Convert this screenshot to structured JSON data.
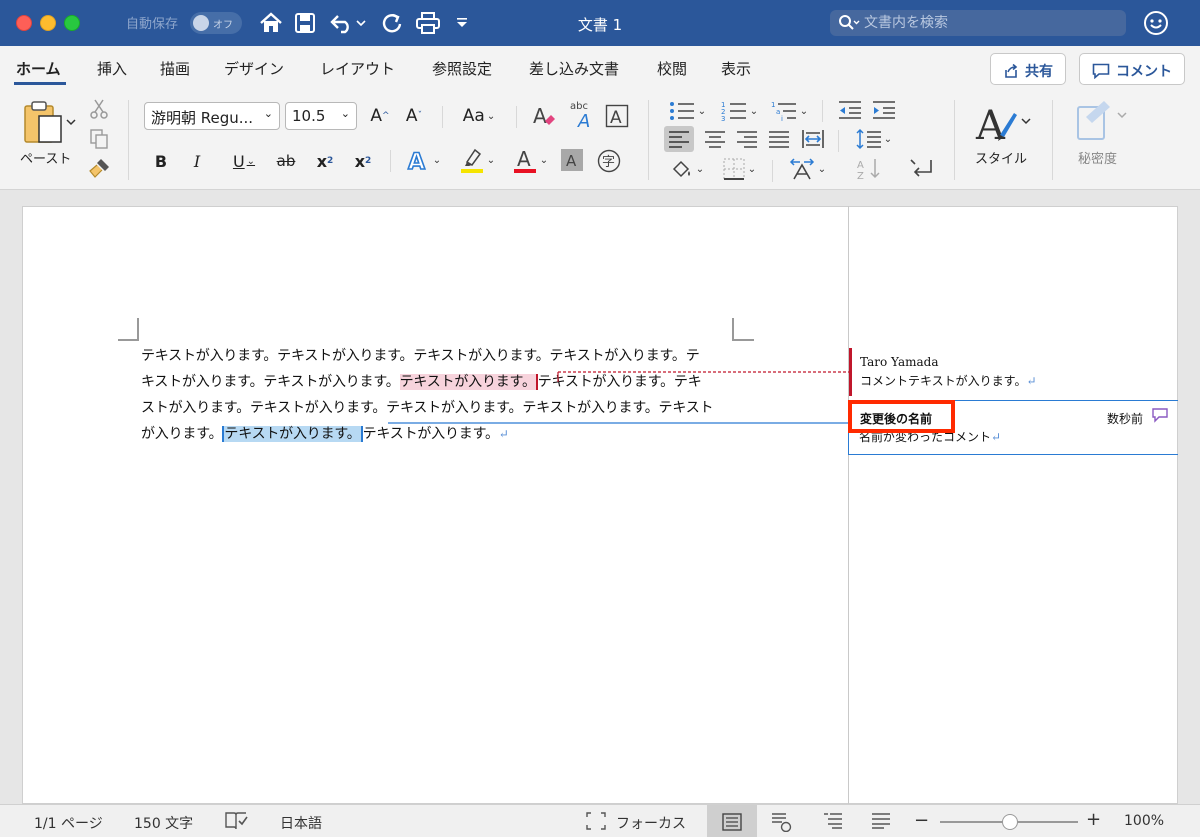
{
  "titlebar": {
    "autosave_label": "自動保存",
    "autosave_state": "オフ",
    "document_title": "文書 1",
    "search_placeholder": "文書内を検索",
    "icons": [
      "home-icon",
      "save-icon",
      "undo-icon",
      "redo-icon",
      "print-icon",
      "customize-icon",
      "smiley-feedback-icon"
    ]
  },
  "tabs": [
    "ホーム",
    "挿入",
    "描画",
    "デザイン",
    "レイアウト",
    "参照設定",
    "差し込み文書",
    "校閲",
    "表示"
  ],
  "active_tab": "ホーム",
  "share_label": "共有",
  "comment_label": "コメント",
  "ribbon": {
    "paste_label": "ペースト",
    "font_name": "游明朝 Regu...",
    "font_size": "10.5",
    "change_case": "Aa",
    "style_label": "スタイル",
    "sensitivity_label": "秘密度",
    "bold": "B",
    "italic": "I",
    "underline": "U",
    "strike": "ab",
    "subscript": "x",
    "superscript": "x",
    "font_color_letter": "A",
    "phonetic": "字",
    "ruby": "abc"
  },
  "document": {
    "line1": "テキストが入ります。テキストが入ります。テキストが入ります。テキストが入ります。テ",
    "line2_a": "キストが入ります。テキストが入ります。",
    "line2_highlight": "テキストが入ります。",
    "line2_b": "テキストが入ります。テキ",
    "line3": "ストが入ります。テキストが入ります。テキストが入ります。テキストが入ります。テキスト",
    "line4_a": "が入ります。",
    "line4_highlight": "テキストが入ります。",
    "line4_b": "テキストが入ります。",
    "para_mark": "↵"
  },
  "comments": [
    {
      "author": "Taro Yamada",
      "text": "コメントテキストが入ります。",
      "time": ""
    },
    {
      "author": "変更後の名前",
      "text": "名前が変わったコメント",
      "time": "数秒前"
    }
  ],
  "accent_color": "#2b579a",
  "highlight_box_color": "#ff2a00",
  "statusbar": {
    "page": "1/1 ページ",
    "words": "150 文字",
    "language": "日本語",
    "focus": "フォーカス",
    "zoom": "100%",
    "zoom_level": 1.0
  }
}
